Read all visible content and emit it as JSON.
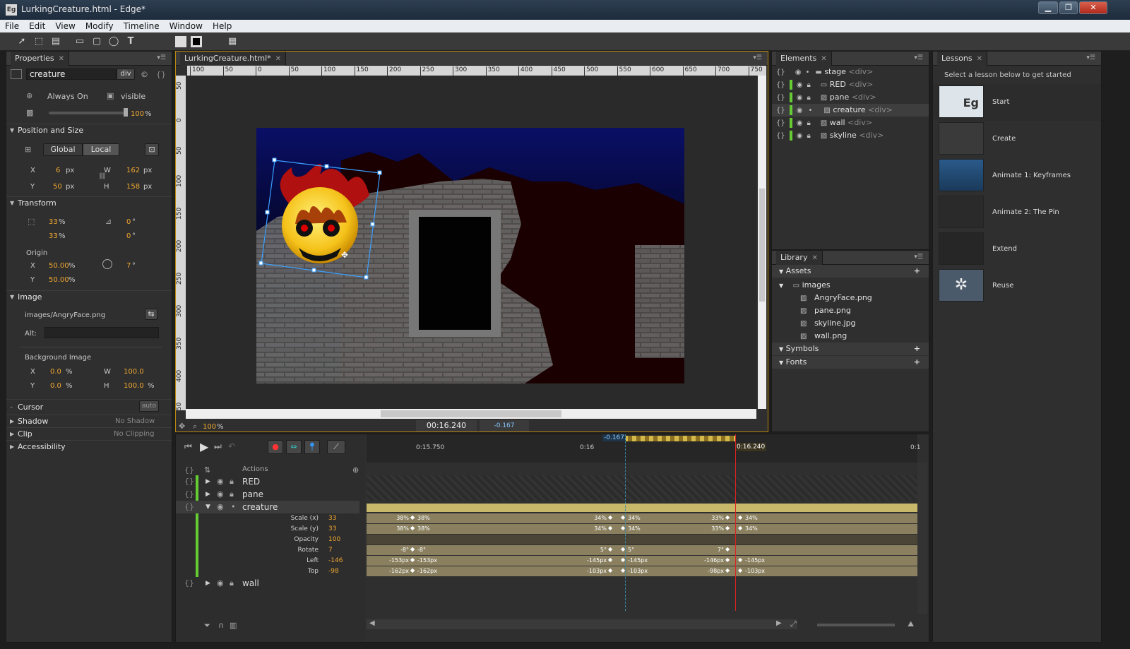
{
  "window": {
    "title": "LurkingCreature.html - Edge*",
    "logo": "Eg",
    "controls": [
      "minimize",
      "maximize",
      "close"
    ]
  },
  "menu": [
    "File",
    "Edit",
    "View",
    "Modify",
    "Timeline",
    "Window",
    "Help"
  ],
  "properties": {
    "tab": "Properties",
    "element_name": "creature",
    "element_tag": "div",
    "display": "Always On",
    "visibility": "visible",
    "opacity": "100",
    "opacity_unit": "%",
    "sections": {
      "position": "Position and Size",
      "transform": "Transform",
      "image": "Image",
      "cursor": "Cursor",
      "shadow": "Shadow",
      "clip": "Clip",
      "accessibility": "Accessibility"
    },
    "global_label": "Global",
    "local_label": "Local",
    "x": "6",
    "y": "50",
    "w": "162",
    "h": "158",
    "px": "px",
    "scale_x": "33",
    "scale_y": "33",
    "skew_x": "0",
    "skew_y": "0",
    "pct": "%",
    "deg": "°",
    "origin_label": "Origin",
    "origin_x": "50.00",
    "origin_y": "50.00",
    "rotate": "7",
    "image_path": "images/AngryFace.png",
    "alt_label": "Alt:",
    "bg_label": "Background Image",
    "bg_x": "0.0",
    "bg_y": "0.0",
    "bg_w": "100.0",
    "bg_h": "100.0",
    "cursor_value": "auto",
    "shadow_value": "No Shadow",
    "clip_value": "No Clipping",
    "lx": "X",
    "ly": "Y",
    "lw": "W",
    "lh": "H"
  },
  "stage": {
    "tab": "LurkingCreature.html*",
    "ruler_top": [
      "100",
      "50",
      "0",
      "50",
      "100",
      "150",
      "200",
      "250",
      "300",
      "350",
      "400",
      "450",
      "500",
      "550",
      "600",
      "650",
      "700",
      "750"
    ],
    "ruler_left": [
      "50",
      "0",
      "50",
      "100",
      "150",
      "200",
      "250",
      "300",
      "350",
      "400",
      "450"
    ],
    "zoom": "100",
    "zoom_unit": "%",
    "time": "00:16.240",
    "time_offset": "-0.167"
  },
  "elements": {
    "tab": "Elements",
    "items": [
      {
        "name": "stage",
        "tag": "<div>"
      },
      {
        "name": "RED",
        "tag": "<div>"
      },
      {
        "name": "pane",
        "tag": "<div>"
      },
      {
        "name": "creature",
        "tag": "<div>"
      },
      {
        "name": "wall",
        "tag": "<div>"
      },
      {
        "name": "skyline",
        "tag": "<div>"
      }
    ]
  },
  "library": {
    "tab": "Library",
    "assets": "Assets",
    "images": "images",
    "files": [
      "AngryFace.png",
      "pane.png",
      "skyline.jpg",
      "wall.png"
    ],
    "symbols": "Symbols",
    "fonts": "Fonts"
  },
  "lessons": {
    "tab": "Lessons",
    "intro": "Select a lesson below to get started",
    "items": [
      "Start",
      "Create",
      "Animate 1: Keyframes",
      "Animate 2: The Pin",
      "Extend",
      "Reuse"
    ],
    "thumb_eg": "Eg"
  },
  "timeline": {
    "actions": "Actions",
    "layers": [
      "RED",
      "pane",
      "creature",
      "wall"
    ],
    "times": [
      "0:15.750",
      "0:16",
      "0:16.240",
      "0:1"
    ],
    "pin_time": "-0.167",
    "props": [
      {
        "name": "Scale (x)",
        "value": "33",
        "k": [
          "38%",
          "38%",
          "34%",
          "34%",
          "33%",
          "34%"
        ]
      },
      {
        "name": "Scale (y)",
        "value": "33",
        "k": [
          "38%",
          "38%",
          "34%",
          "34%",
          "33%",
          "34%"
        ]
      },
      {
        "name": "Opacity",
        "value": "100",
        "k": []
      },
      {
        "name": "Rotate",
        "value": "7",
        "k": [
          "-8°",
          "-8°",
          "5°",
          "5°",
          "7°",
          ""
        ]
      },
      {
        "name": "Left",
        "value": "-146",
        "k": [
          "-153px",
          "-153px",
          "-145px",
          "-145px",
          "-146px",
          "-145px"
        ]
      },
      {
        "name": "Top",
        "value": "-98",
        "k": [
          "-162px",
          "-162px",
          "-103px",
          "-103px",
          "-98px",
          "-103px"
        ]
      }
    ]
  }
}
